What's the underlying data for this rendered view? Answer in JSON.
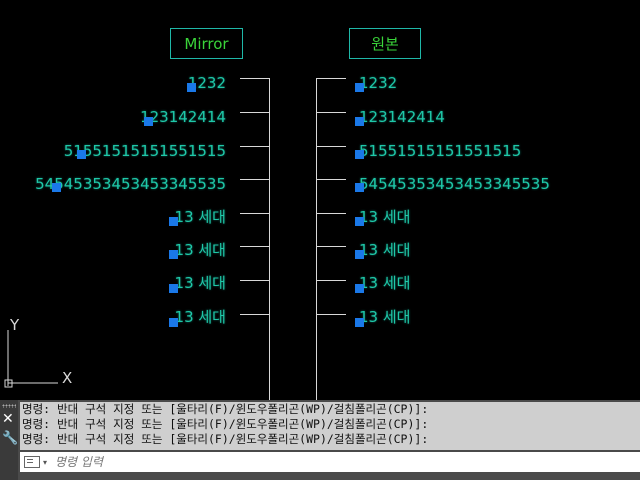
{
  "headers": {
    "mirror": "Mirror",
    "original": "원본"
  },
  "left_labels": [
    "1232",
    "123142414",
    "51551515151551515",
    "54545353453453345535",
    "13 세대",
    "13 세대",
    "13 세대",
    "13 세대"
  ],
  "right_labels": [
    "1232",
    "123142414",
    "51551515151551515",
    "54545353453453345535",
    "13 세대",
    "13 세대",
    "13 세대",
    "13 세대"
  ],
  "ucs": {
    "x_label": "X",
    "y_label": "Y"
  },
  "command": {
    "history": [
      "명령: 반대 구석 지정 또는 [울타리(F)/윈도우폴리곤(WP)/걸침폴리곤(CP)]:",
      "명령: 반대 구석 지정 또는 [울타리(F)/윈도우폴리곤(WP)/걸침폴리곤(CP)]:",
      "명령: 반대 구석 지정 또는 [울타리(F)/윈도우폴리곤(WP)/걸침폴리곤(CP)]:"
    ],
    "placeholder": "명령 입력",
    "close_glyph": "✕",
    "settings_glyph": "🔧",
    "caret_glyph": "▾"
  },
  "colors": {
    "text": "#1fc8a8",
    "header_text": "#3ad43a",
    "grip": "#1a78e8",
    "line": "#d8d8d8",
    "background": "#000000"
  }
}
